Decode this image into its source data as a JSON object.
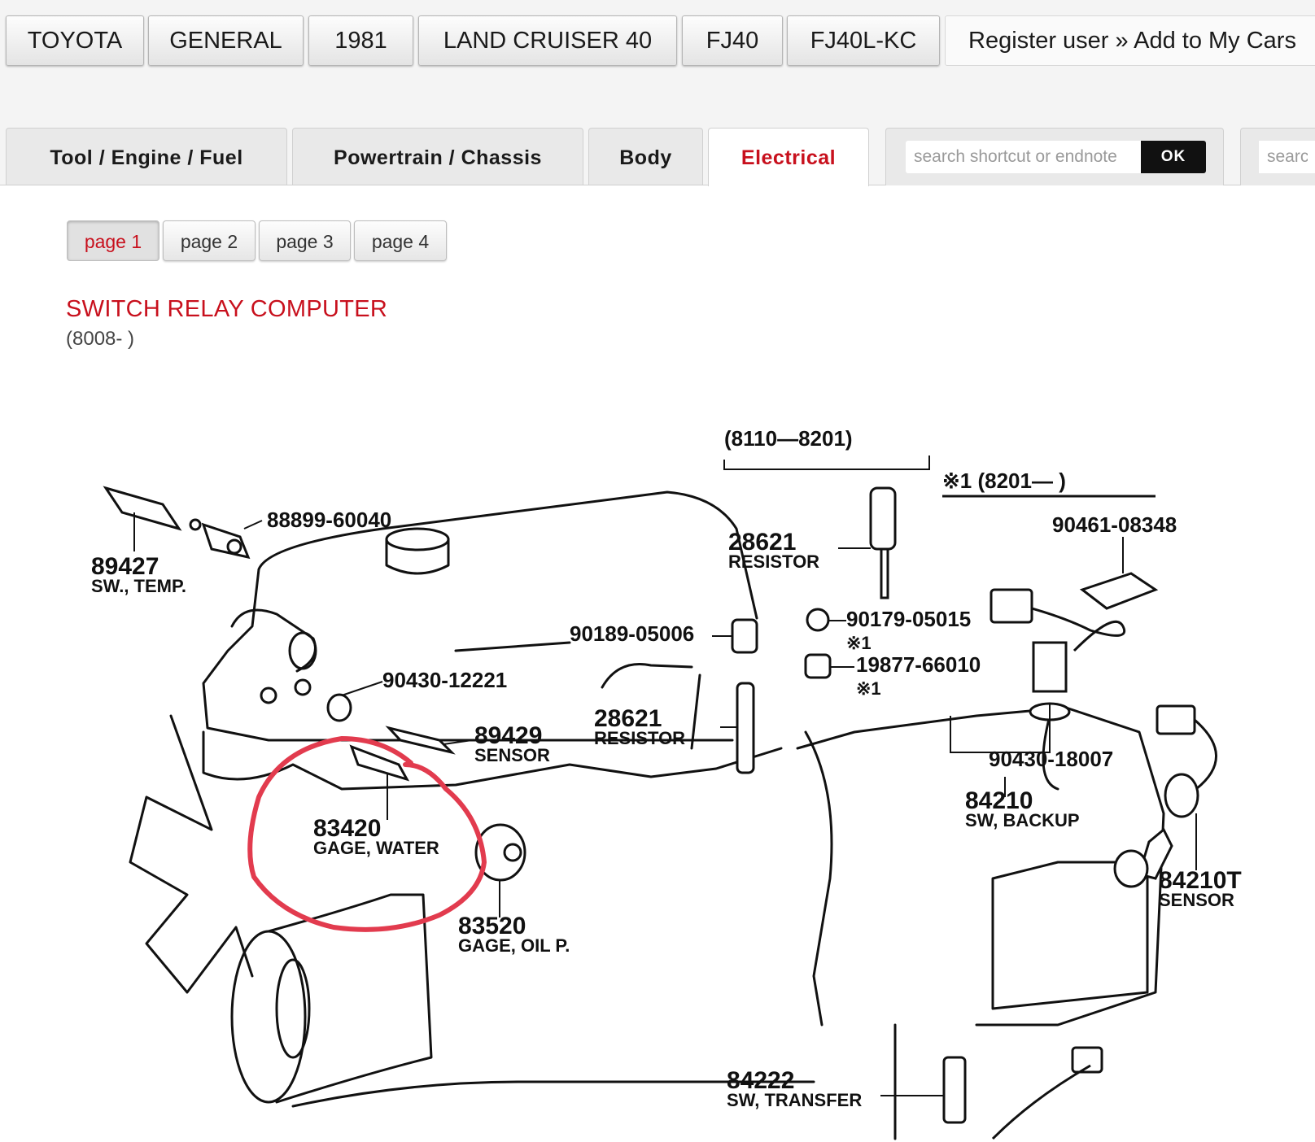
{
  "breadcrumbs": [
    "TOYOTA",
    "GENERAL",
    "1981",
    "LAND CRUISER 40",
    "FJ40",
    "FJ40L-KC"
  ],
  "register_text": "Register user » Add to My Cars",
  "tabs": [
    {
      "label": "Tool / Engine / Fuel",
      "active": false
    },
    {
      "label": "Powertrain / Chassis",
      "active": false
    },
    {
      "label": "Body",
      "active": false
    },
    {
      "label": "Electrical",
      "active": true
    }
  ],
  "search": {
    "placeholder": "search shortcut or endnote",
    "ok_label": "OK",
    "placeholder2": "search"
  },
  "pages": [
    {
      "label": "page 1",
      "active": true
    },
    {
      "label": "page 2",
      "active": false
    },
    {
      "label": "page 3",
      "active": false
    },
    {
      "label": "page 4",
      "active": false
    }
  ],
  "section": {
    "title": "SWITCH RELAY COMPUTER",
    "subtitle": "(8008- )"
  },
  "diagram": {
    "range_a": "(8110—8201)",
    "range_b": "※1 (8201—          )",
    "parts": [
      {
        "number": "88899-60040",
        "name": ""
      },
      {
        "number": "89427",
        "name": "SW., TEMP."
      },
      {
        "number": "28621",
        "name": "RESISTOR"
      },
      {
        "number": "90461-08348",
        "name": ""
      },
      {
        "number": "90189-05006",
        "name": ""
      },
      {
        "number": "90179-05015",
        "name": "※1"
      },
      {
        "number": "19877-66010",
        "name": "※1"
      },
      {
        "number": "90430-12221",
        "name": ""
      },
      {
        "number": "28621",
        "name": "RESISTOR"
      },
      {
        "number": "89429",
        "name": "SENSOR"
      },
      {
        "number": "90430-18007",
        "name": ""
      },
      {
        "number": "84210",
        "name": "SW, BACKUP"
      },
      {
        "number": "83420",
        "name": "GAGE, WATER"
      },
      {
        "number": "83520",
        "name": "GAGE, OIL P."
      },
      {
        "number": "84210T",
        "name": "SENSOR"
      },
      {
        "number": "84222",
        "name": "SW, TRANSFER"
      }
    ],
    "highlight_color": "#e23b4e"
  }
}
